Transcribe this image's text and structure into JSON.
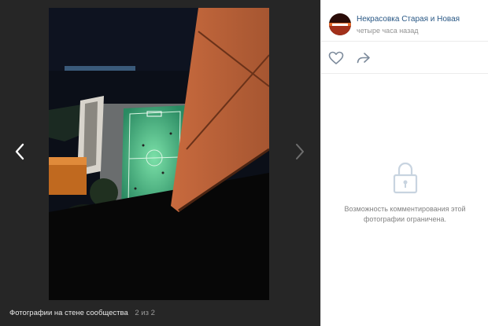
{
  "viewer": {
    "caption": "Фотографии на стене сообщества",
    "counter": "2 из 2"
  },
  "post": {
    "group_name": "Некрасовка Старая и Новая",
    "time": "четыре часа назад"
  },
  "comments": {
    "restricted_line1": "Возможность комментирования этой",
    "restricted_line2": "фотографии ограничена."
  },
  "icons": {
    "prev": "chevron-left-icon",
    "next": "chevron-right-icon",
    "like": "heart-icon",
    "share": "share-arrow-icon",
    "lock": "lock-icon"
  },
  "colors": {
    "viewer_bg": "#262626",
    "link": "#2a5885",
    "muted": "#939393",
    "pitch": "#2f9a6e"
  }
}
